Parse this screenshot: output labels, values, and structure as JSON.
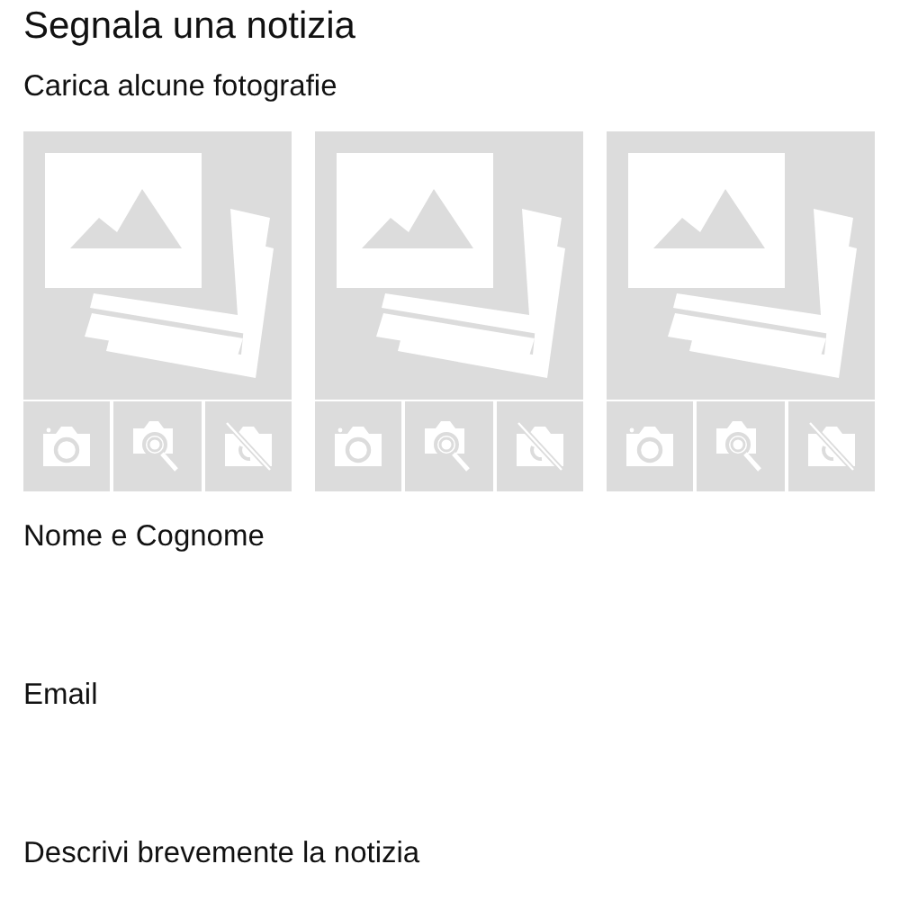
{
  "title": "Segnala una notizia",
  "subtitle": "Carica alcune fotografie",
  "photo_slots": [
    {
      "kind": "empty"
    },
    {
      "kind": "empty"
    },
    {
      "kind": "empty"
    }
  ],
  "fields": [
    {
      "label": "Nome e Cognome"
    },
    {
      "label": "Email"
    },
    {
      "label": "Descrivi brevemente la notizia"
    }
  ]
}
